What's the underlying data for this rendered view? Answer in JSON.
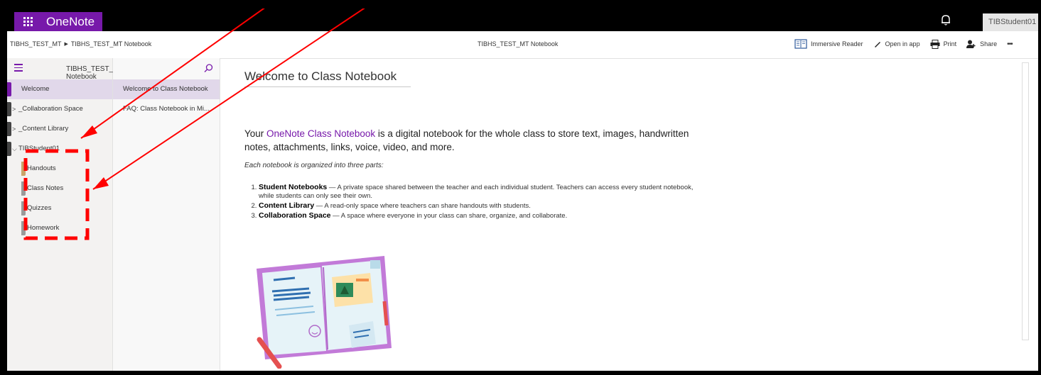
{
  "app": {
    "name": "OneNote",
    "account": "TIBStudent01"
  },
  "breadcrumb": {
    "items": [
      "TIBHS_TEST_MT",
      "TIBHS_TEST_MT Notebook"
    ]
  },
  "center_title": "TIBHS_TEST_MT Notebook",
  "commands": {
    "immersive_reader": "Immersive Reader",
    "open_in_app": "Open in app",
    "print": "Print",
    "share": "Share",
    "more": "•••"
  },
  "section_pane": {
    "notebook_title": "TIBHS_TEST_MT Notebook",
    "sections": {
      "welcome": "Welcome",
      "collaboration": "_Collaboration Space",
      "content_library": "_Content Library",
      "student": "TIBStudent01",
      "handouts": "Handouts",
      "class_notes": "Class Notes",
      "quizzes": "Quizzes",
      "homework": "Homework"
    },
    "collapsed_chevron": ">",
    "expanded_chevron": "⌵"
  },
  "page_pane": {
    "pages": [
      "Welcome to Class Notebook",
      "FAQ: Class Notebook in Mi..."
    ]
  },
  "content": {
    "title": "Welcome to Class Notebook",
    "intro_before": "Your ",
    "intro_link": "OneNote Class Notebook",
    "intro_after": " is a digital notebook for the whole class to store text, images, handwritten notes, attachments, links, voice, video, and more.",
    "organized": "Each notebook is organized into three parts:",
    "parts": [
      {
        "name": "Student Notebooks",
        "desc": " — A private space shared between the teacher and each individual student. Teachers can access every student notebook, while students can only see their own."
      },
      {
        "name": "Content Library",
        "desc": " — A read-only space where teachers can share handouts with students."
      },
      {
        "name": "Collaboration Space",
        "desc": " —  A space where everyone in your class can share, organize, and collaborate."
      }
    ]
  },
  "colors": {
    "brand": "#7719aa",
    "annotation": "#ff0000",
    "selection": "#e1d8ea"
  }
}
